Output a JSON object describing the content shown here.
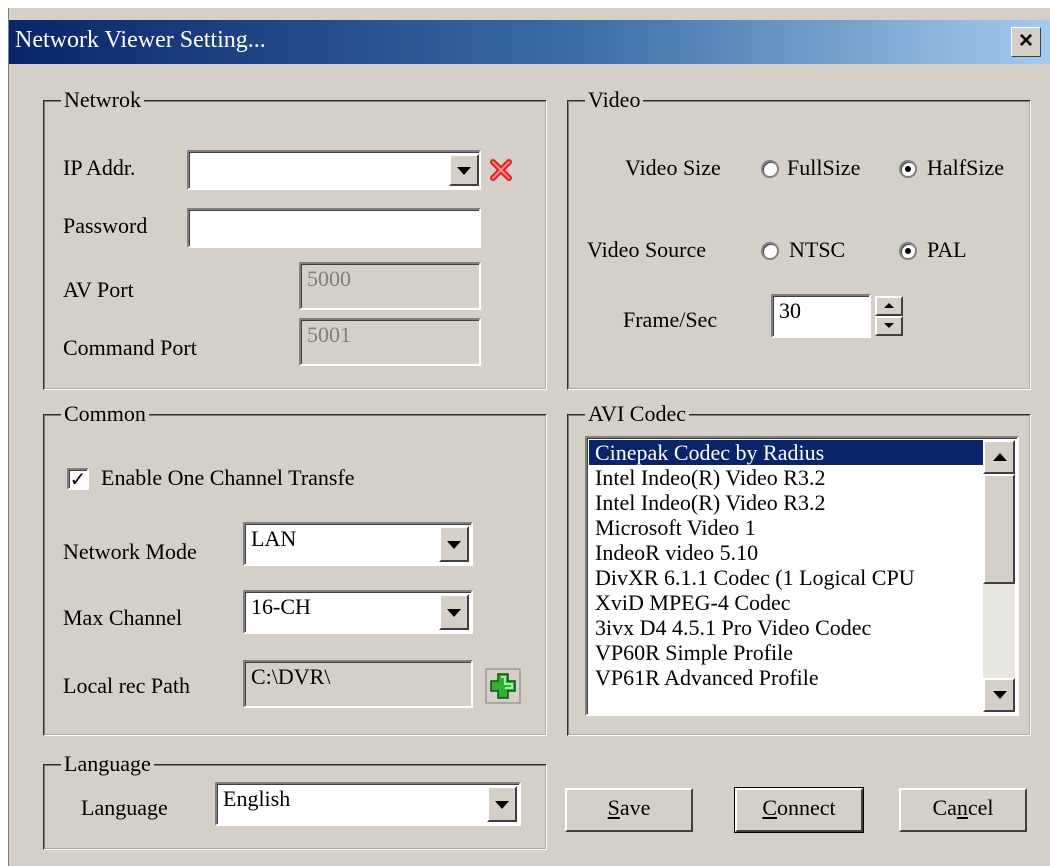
{
  "window": {
    "title": "Network Viewer Setting...",
    "close_label": "×"
  },
  "network": {
    "group_label": "Netwrok",
    "ip_label": "IP Addr.",
    "ip_value": "",
    "password_label": "Password",
    "password_value": "",
    "av_port_label": "AV Port",
    "av_port_value": "5000",
    "command_port_label": "Command Port",
    "command_port_value": "5001"
  },
  "video": {
    "group_label": "Video",
    "size_label": "Video Size",
    "size_options": [
      "FullSize",
      "HalfSize"
    ],
    "size_selected": "HalfSize",
    "source_label": "Video Source",
    "source_options": [
      "NTSC",
      "PAL"
    ],
    "source_selected": "PAL",
    "fps_label": "Frame/Sec",
    "fps_value": "30"
  },
  "common": {
    "group_label": "Common",
    "enable_one_channel_label": "Enable One Channel Transfe",
    "enable_one_channel_checked": true,
    "network_mode_label": "Network Mode",
    "network_mode_value": "LAN",
    "max_channel_label": "Max Channel",
    "max_channel_value": "16-CH",
    "local_rec_label": "Local rec Path",
    "local_rec_value": "C:\\DVR\\"
  },
  "avi_codec": {
    "group_label": "AVI Codec",
    "items": [
      "Cinepak Codec by Radius",
      "Intel Indeo(R) Video R3.2",
      "Intel Indeo(R) Video R3.2",
      "Microsoft Video 1",
      "IndeoR video 5.10",
      "DivXR 6.1.1 Codec (1 Logical CPU",
      "XviD MPEG-4 Codec",
      "3ivx D4 4.5.1 Pro Video Codec",
      "VP60R Simple Profile",
      "VP61R Advanced Profile"
    ],
    "selected_index": 0
  },
  "language": {
    "group_label": "Language",
    "label": "Language",
    "value": "English"
  },
  "buttons": {
    "save": {
      "mnemonic": "S",
      "rest": "ave"
    },
    "connect": {
      "mnemonic": "C",
      "rest": "onnect"
    },
    "cancel": {
      "pre": "Ca",
      "mnemonic": "n",
      "rest": "cel"
    }
  },
  "colors": {
    "title_start": "#0a246a",
    "title_end": "#a6caf0",
    "face": "#d4d0c8",
    "remove_icon": "#e02020",
    "add_icon": "#20a020"
  }
}
